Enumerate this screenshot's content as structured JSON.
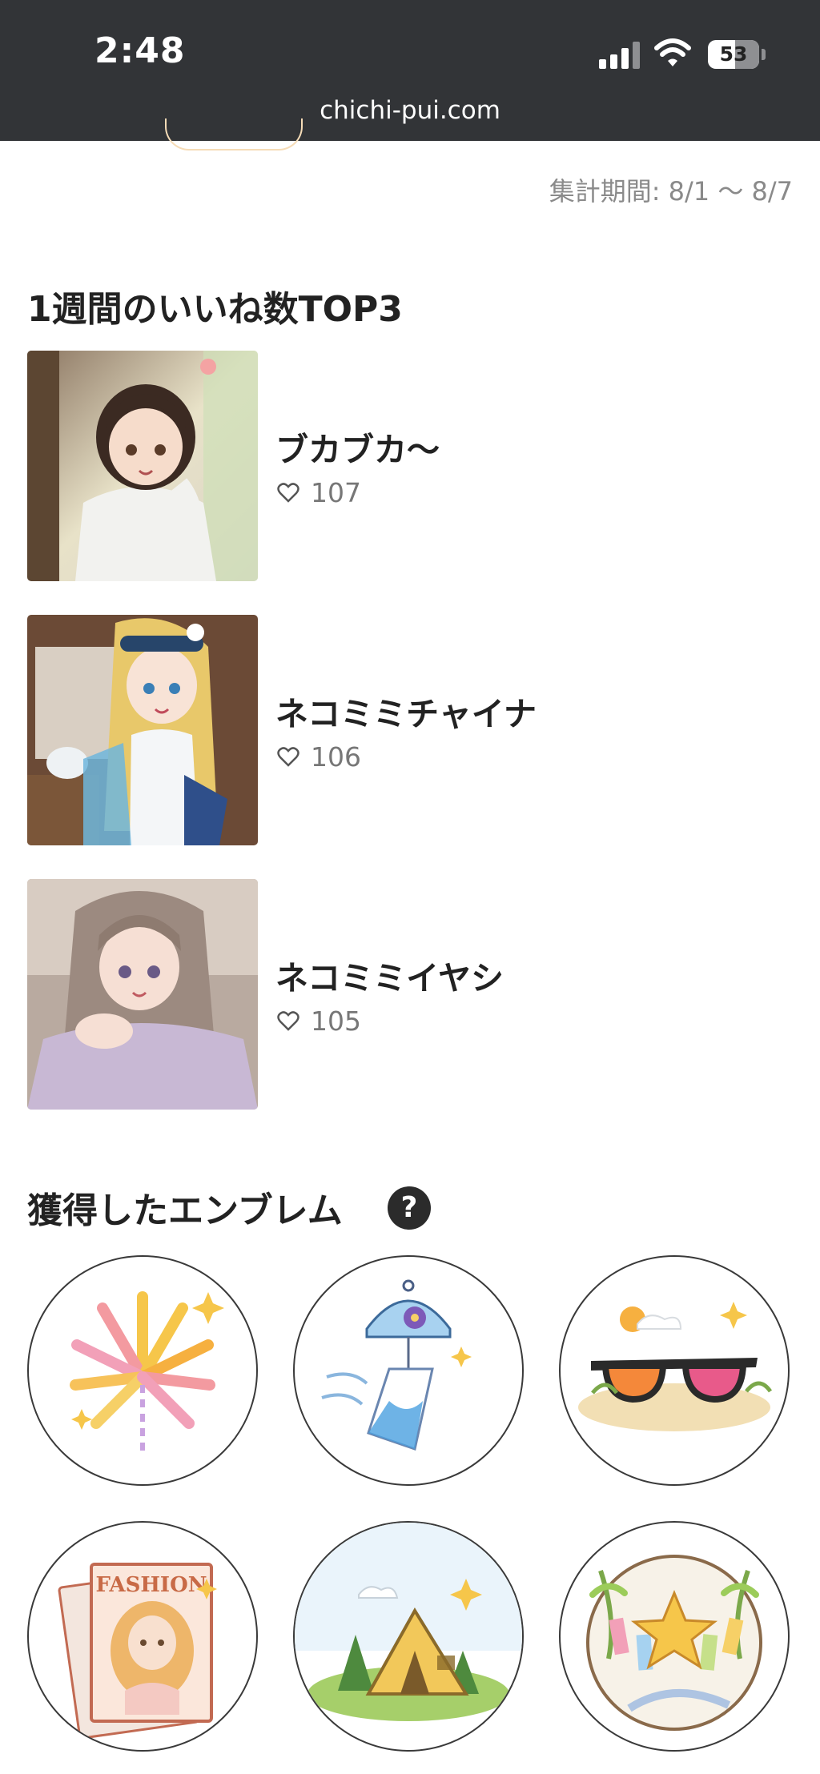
{
  "status_bar": {
    "time": "2:48",
    "battery": "53"
  },
  "browser": {
    "url": "chichi-pui.com"
  },
  "period": "集計期間: 8/1 〜 8/7",
  "top_likes": {
    "title": "1週間のいいね数TOP3",
    "items": [
      {
        "title": "ブカブカ〜",
        "likes": "107"
      },
      {
        "title": "ネコミミチャイナ",
        "likes": "106"
      },
      {
        "title": "ネコミミイヤシ",
        "likes": "105"
      }
    ]
  },
  "emblems": {
    "title": "獲得したエンブレム",
    "help_label": "?",
    "items": [
      {
        "icon": "fireworks-icon"
      },
      {
        "icon": "wind-chime-icon"
      },
      {
        "icon": "sunglasses-beach-icon"
      },
      {
        "icon": "fashion-magazine-icon"
      },
      {
        "icon": "camping-tent-icon"
      },
      {
        "icon": "tanabata-star-icon"
      }
    ],
    "magazine_label": "FASHION"
  },
  "colors": {
    "status_bar": "#323437",
    "muted_text": "#8a8a8a",
    "like_text": "#777777"
  }
}
